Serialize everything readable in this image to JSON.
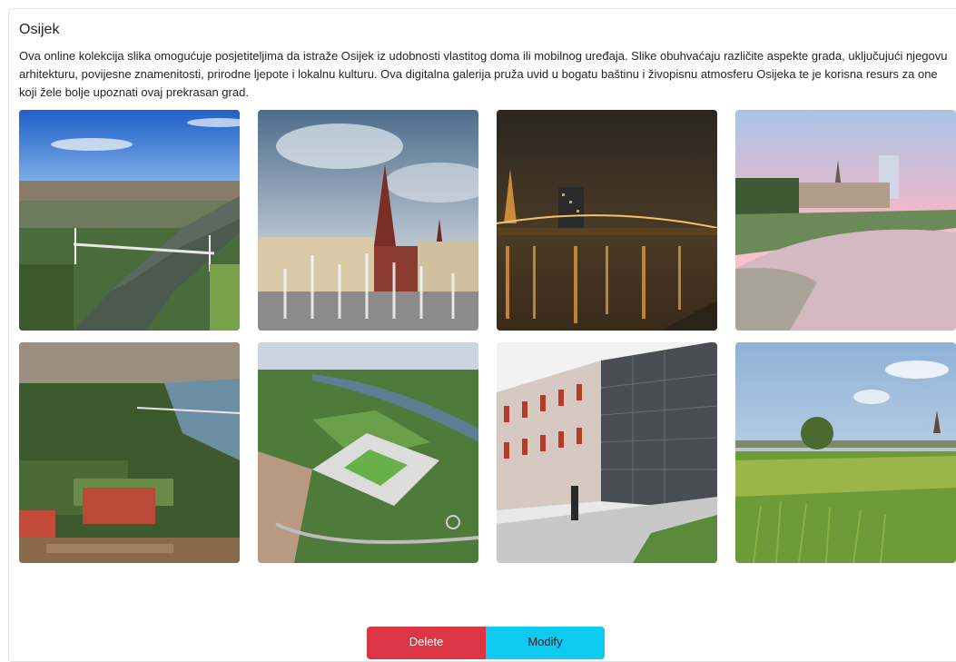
{
  "header": {
    "title": "Osijek",
    "description": "Ova online kolekcija slika omogućuje posjetiteljima da istraže Osijek iz udobnosti vlastitog doma ili mobilnog uređaja. Slike obuhvaćaju različite aspekte grada, uključujući njegovu arhitekturu, povijesne znamenitosti, prirodne ljepote i lokalnu kulturu. Ova digitalna galerija pruža uvid u bogatu baštinu i živopisnu atmosferu Osijeka te je korisna resurs za one koji žele bolje upoznati ovaj prekrasan grad."
  },
  "gallery": {
    "photos": [
      {
        "name": "aerial-bridge-photo"
      },
      {
        "name": "cathedral-fountain-photo"
      },
      {
        "name": "night-river-photo"
      },
      {
        "name": "river-sunset-photo"
      },
      {
        "name": "aerial-fortress-photo"
      },
      {
        "name": "stadium-render-photo"
      },
      {
        "name": "modern-building-photo"
      },
      {
        "name": "river-meadow-photo"
      }
    ]
  },
  "actions": {
    "delete_label": "Delete",
    "modify_label": "Modify"
  },
  "colors": {
    "delete": "#dc3545",
    "modify": "#0dcaf0",
    "border": "#dee2e6"
  }
}
